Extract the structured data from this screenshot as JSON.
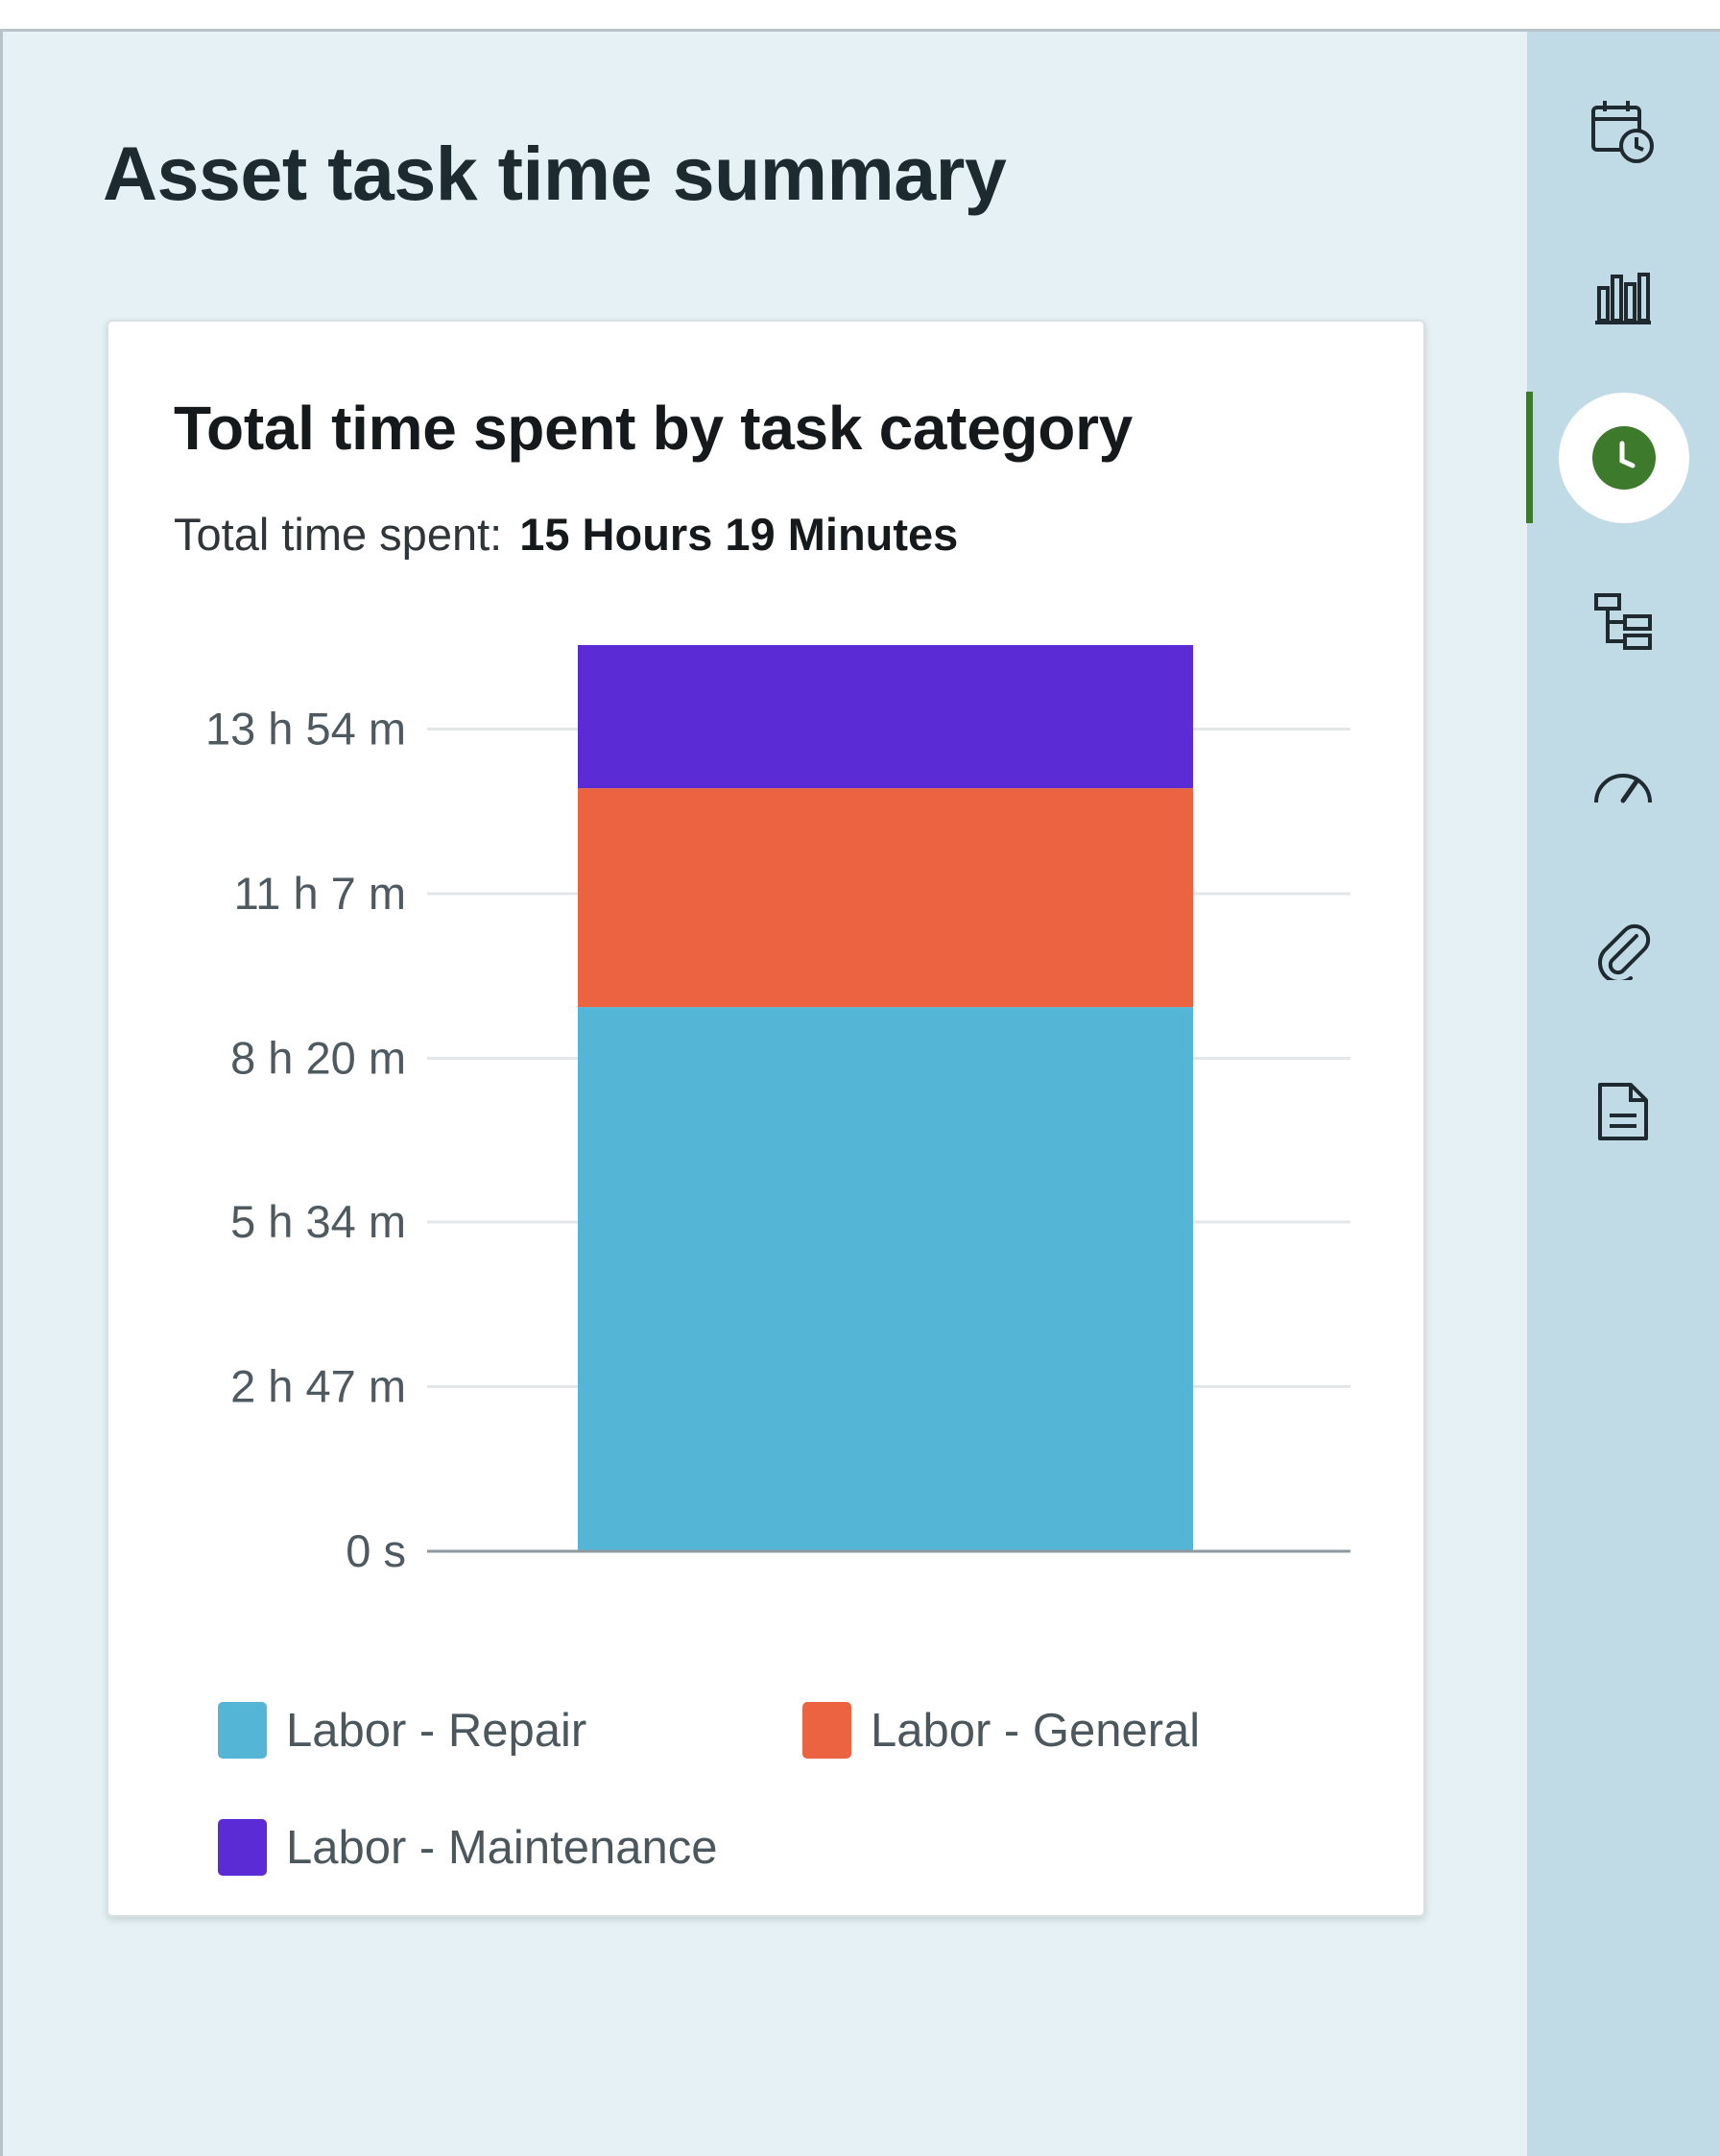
{
  "page": {
    "title": "Asset task time summary"
  },
  "card": {
    "title": "Total time spent by task category",
    "total_label": "Total time spent:",
    "total_value": "15 Hours 19 Minutes"
  },
  "chart_data": {
    "type": "bar",
    "stacked": true,
    "categories": [
      ""
    ],
    "series": [
      {
        "name": "Labor - Repair",
        "color": "#54b5d7",
        "values": [
          9.2
        ]
      },
      {
        "name": "Labor - General",
        "color": "#ec6341",
        "values": [
          3.7
        ]
      },
      {
        "name": "Labor - Maintenance",
        "color": "#5b2bd5",
        "values": [
          2.42
        ]
      }
    ],
    "y_ticks": [
      "0 s",
      "2 h 47 m",
      "5 h 34 m",
      "8 h 20 m",
      "11 h 7 m",
      "13 h 54 m"
    ],
    "y_tick_values": [
      0,
      2.783,
      5.567,
      8.333,
      11.117,
      13.9
    ],
    "ylim": [
      0,
      15.32
    ],
    "grid": true,
    "legend_position": "bottom"
  },
  "rail": {
    "items": [
      {
        "name": "calendar-clock-icon"
      },
      {
        "name": "bar-chart-icon"
      },
      {
        "name": "clock-icon",
        "active": true
      },
      {
        "name": "hierarchy-icon"
      },
      {
        "name": "speedometer-icon"
      },
      {
        "name": "paperclip-icon"
      },
      {
        "name": "document-icon"
      }
    ],
    "active_color": "#3e7a2b"
  }
}
